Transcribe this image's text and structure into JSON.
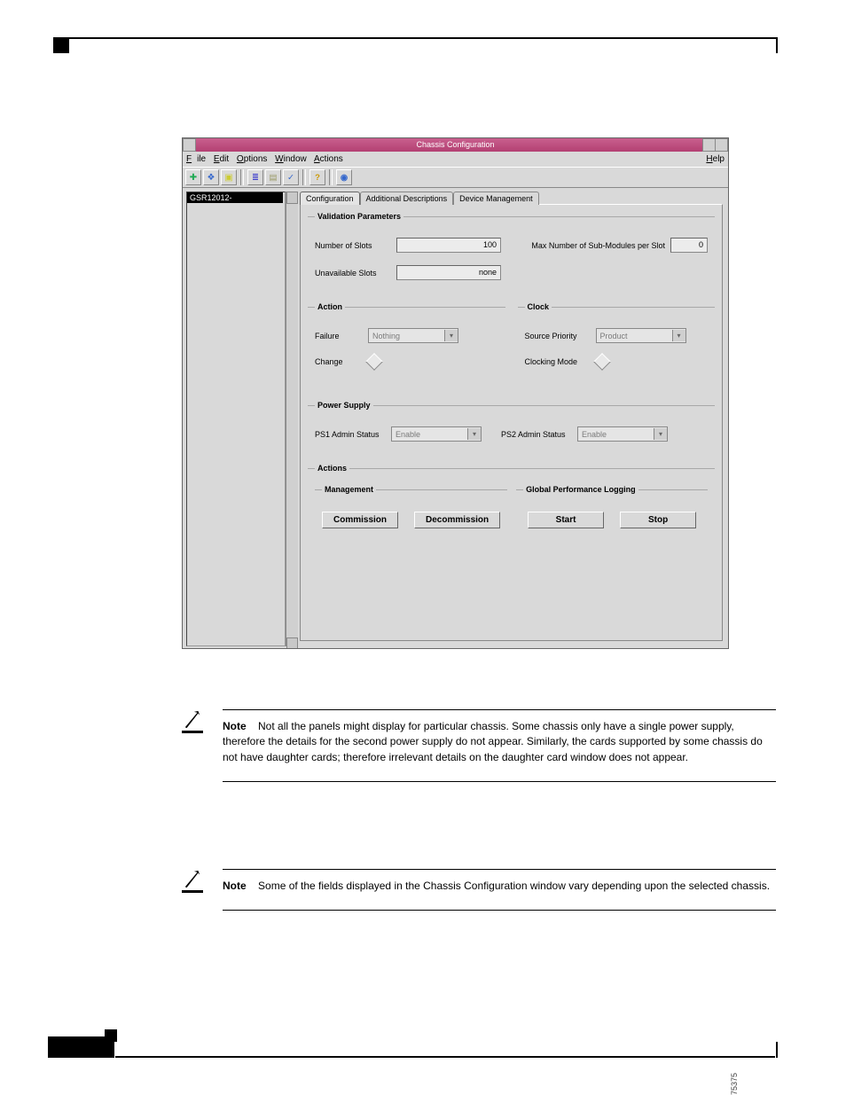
{
  "window": {
    "title": "Chassis Configuration",
    "menu": {
      "file": "File",
      "edit": "Edit",
      "options": "Options",
      "window": "Window",
      "actions": "Actions",
      "help": "Help"
    }
  },
  "tree": {
    "item": "GSR12012-"
  },
  "tabs": {
    "config": "Configuration",
    "addl": "Additional Descriptions",
    "devmgmt": "Device Management"
  },
  "validation": {
    "legend": "Validation Parameters",
    "num_slots_label": "Number of Slots",
    "num_slots_value": "100",
    "max_sub_label": "Max Number of Sub-Modules per Slot",
    "max_sub_value": "0",
    "unavail_label": "Unavailable Slots",
    "unavail_value": "none"
  },
  "action": {
    "legend": "Action",
    "failure_label": "Failure",
    "failure_value": "Nothing",
    "change_label": "Change"
  },
  "clock": {
    "legend": "Clock",
    "src_label": "Source Priority",
    "src_value": "Product",
    "mode_label": "Clocking Mode"
  },
  "power": {
    "legend": "Power Supply",
    "ps1_label": "PS1 Admin Status",
    "ps1_value": "Enable",
    "ps2_label": "PS2 Admin Status",
    "ps2_value": "Enable"
  },
  "actions": {
    "legend": "Actions",
    "mgmt_legend": "Management",
    "commission": "Commission",
    "decommission": "Decommission",
    "gpl_legend": "Global Performance Logging",
    "start": "Start",
    "stop": "Stop"
  },
  "side_number": "75375",
  "notes": {
    "label": "Note",
    "note1": "Not all the panels might display for particular chassis. Some chassis only have a single power supply, therefore the details for the second power supply do not appear. Similarly, the cards supported by some chassis do not have daughter cards; therefore irrelevant details on the daughter card window does not appear.",
    "note2": "Some of the fields displayed in the Chassis Configuration window vary depending upon the selected chassis."
  }
}
